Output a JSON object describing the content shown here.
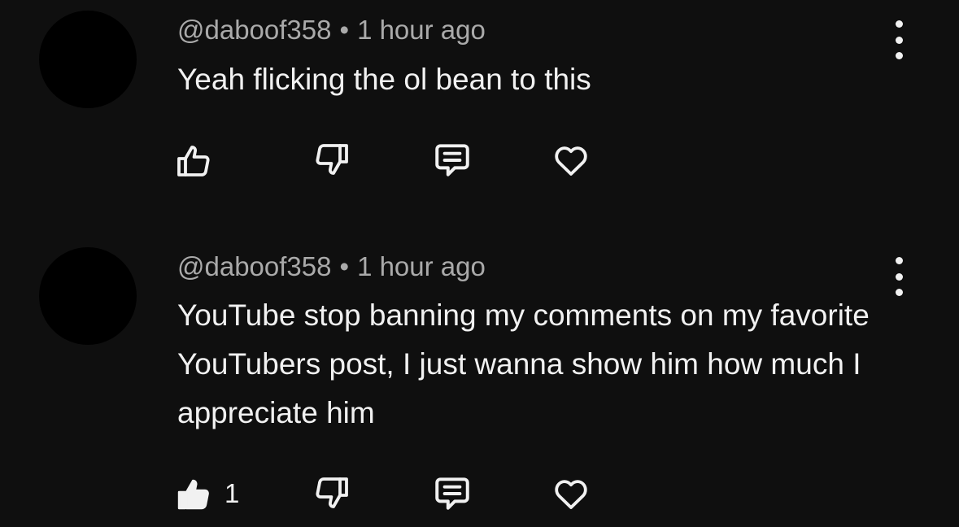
{
  "comments": [
    {
      "author": "@daboof358",
      "separator": "•",
      "time": "1 hour ago",
      "text": "Yeah flicking the ol bean to this",
      "like_count": "",
      "liked": false
    },
    {
      "author": "@daboof358",
      "separator": "•",
      "time": "1 hour ago",
      "text": "YouTube stop banning my comments on my favorite YouTubers post, I just wanna show him how much I appreciate him",
      "like_count": "1",
      "liked": true
    }
  ],
  "icons": {
    "like": "thumbs-up-icon",
    "dislike": "thumbs-down-icon",
    "reply": "reply-comment-icon",
    "heart": "heart-icon",
    "more": "more-vertical-icon"
  },
  "colors": {
    "background": "#0f0f0f",
    "text": "#f1f1f1",
    "meta": "#aaaaaa"
  }
}
